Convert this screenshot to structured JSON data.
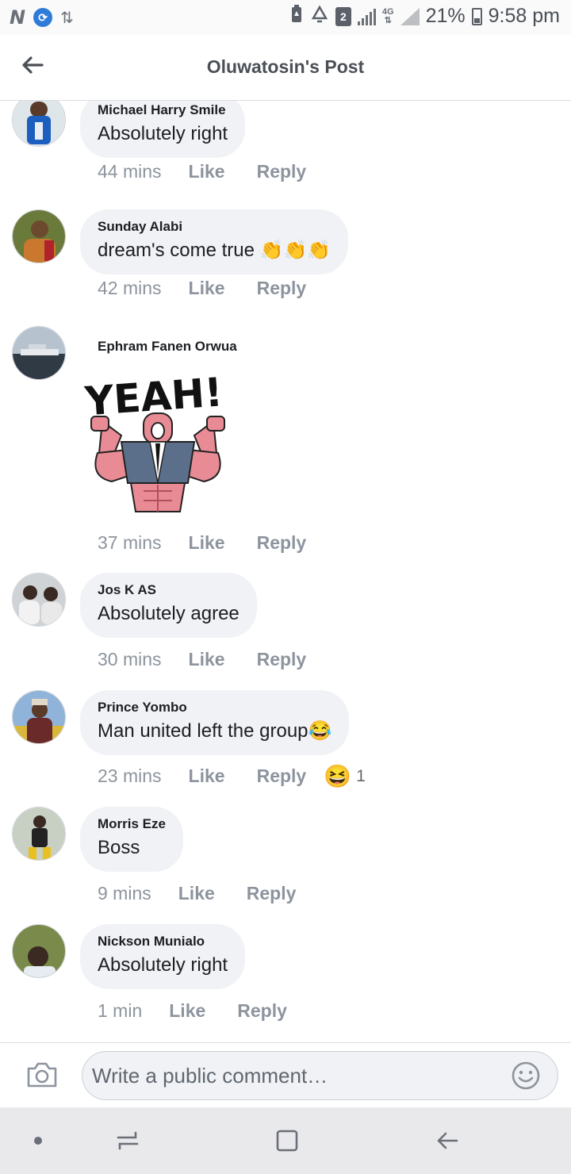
{
  "status_bar": {
    "notif_icons": [
      "n-icon",
      "sync-icon",
      "download-icon"
    ],
    "sim_badge": "2",
    "network": "4G",
    "battery_percent": "21%",
    "time": "9:58 pm"
  },
  "header": {
    "title": "Oluwatosin's Post"
  },
  "comments": [
    {
      "author": "Michael Harry Smile",
      "text": "Absolutely right",
      "time": "44 mins",
      "like": "Like",
      "reply": "Reply"
    },
    {
      "author": "Sunday Alabi",
      "text": "dream's come true ",
      "emoji": "👏👏👏",
      "time": "42 mins",
      "like": "Like",
      "reply": "Reply"
    },
    {
      "author": "Ephram Fanen Orwua",
      "sticker_text": "YEAH!",
      "time": "37 mins",
      "like": "Like",
      "reply": "Reply"
    },
    {
      "author": "Jos K AS",
      "text": "Absolutely agree",
      "time": "30 mins",
      "like": "Like",
      "reply": "Reply"
    },
    {
      "author": "Prince Yombo",
      "text": "Man united left the group",
      "emoji": "😂",
      "time": "23 mins",
      "like": "Like",
      "reply": "Reply",
      "reaction_emoji": "😆",
      "reaction_count": "1"
    },
    {
      "author": "Morris Eze",
      "text": "Boss",
      "time": "9 mins",
      "like": "Like",
      "reply": "Reply"
    },
    {
      "author": "Nickson Munialo",
      "text": "Absolutely right",
      "time": "1 min",
      "like": "Like",
      "reply": "Reply"
    }
  ],
  "composer": {
    "placeholder": "Write a public comment…"
  },
  "colors": {
    "bubble": "#f0f2f5",
    "meta_text": "#8d949e",
    "title_text": "#4b4f56",
    "navbar_bg": "#e9e9ec"
  }
}
